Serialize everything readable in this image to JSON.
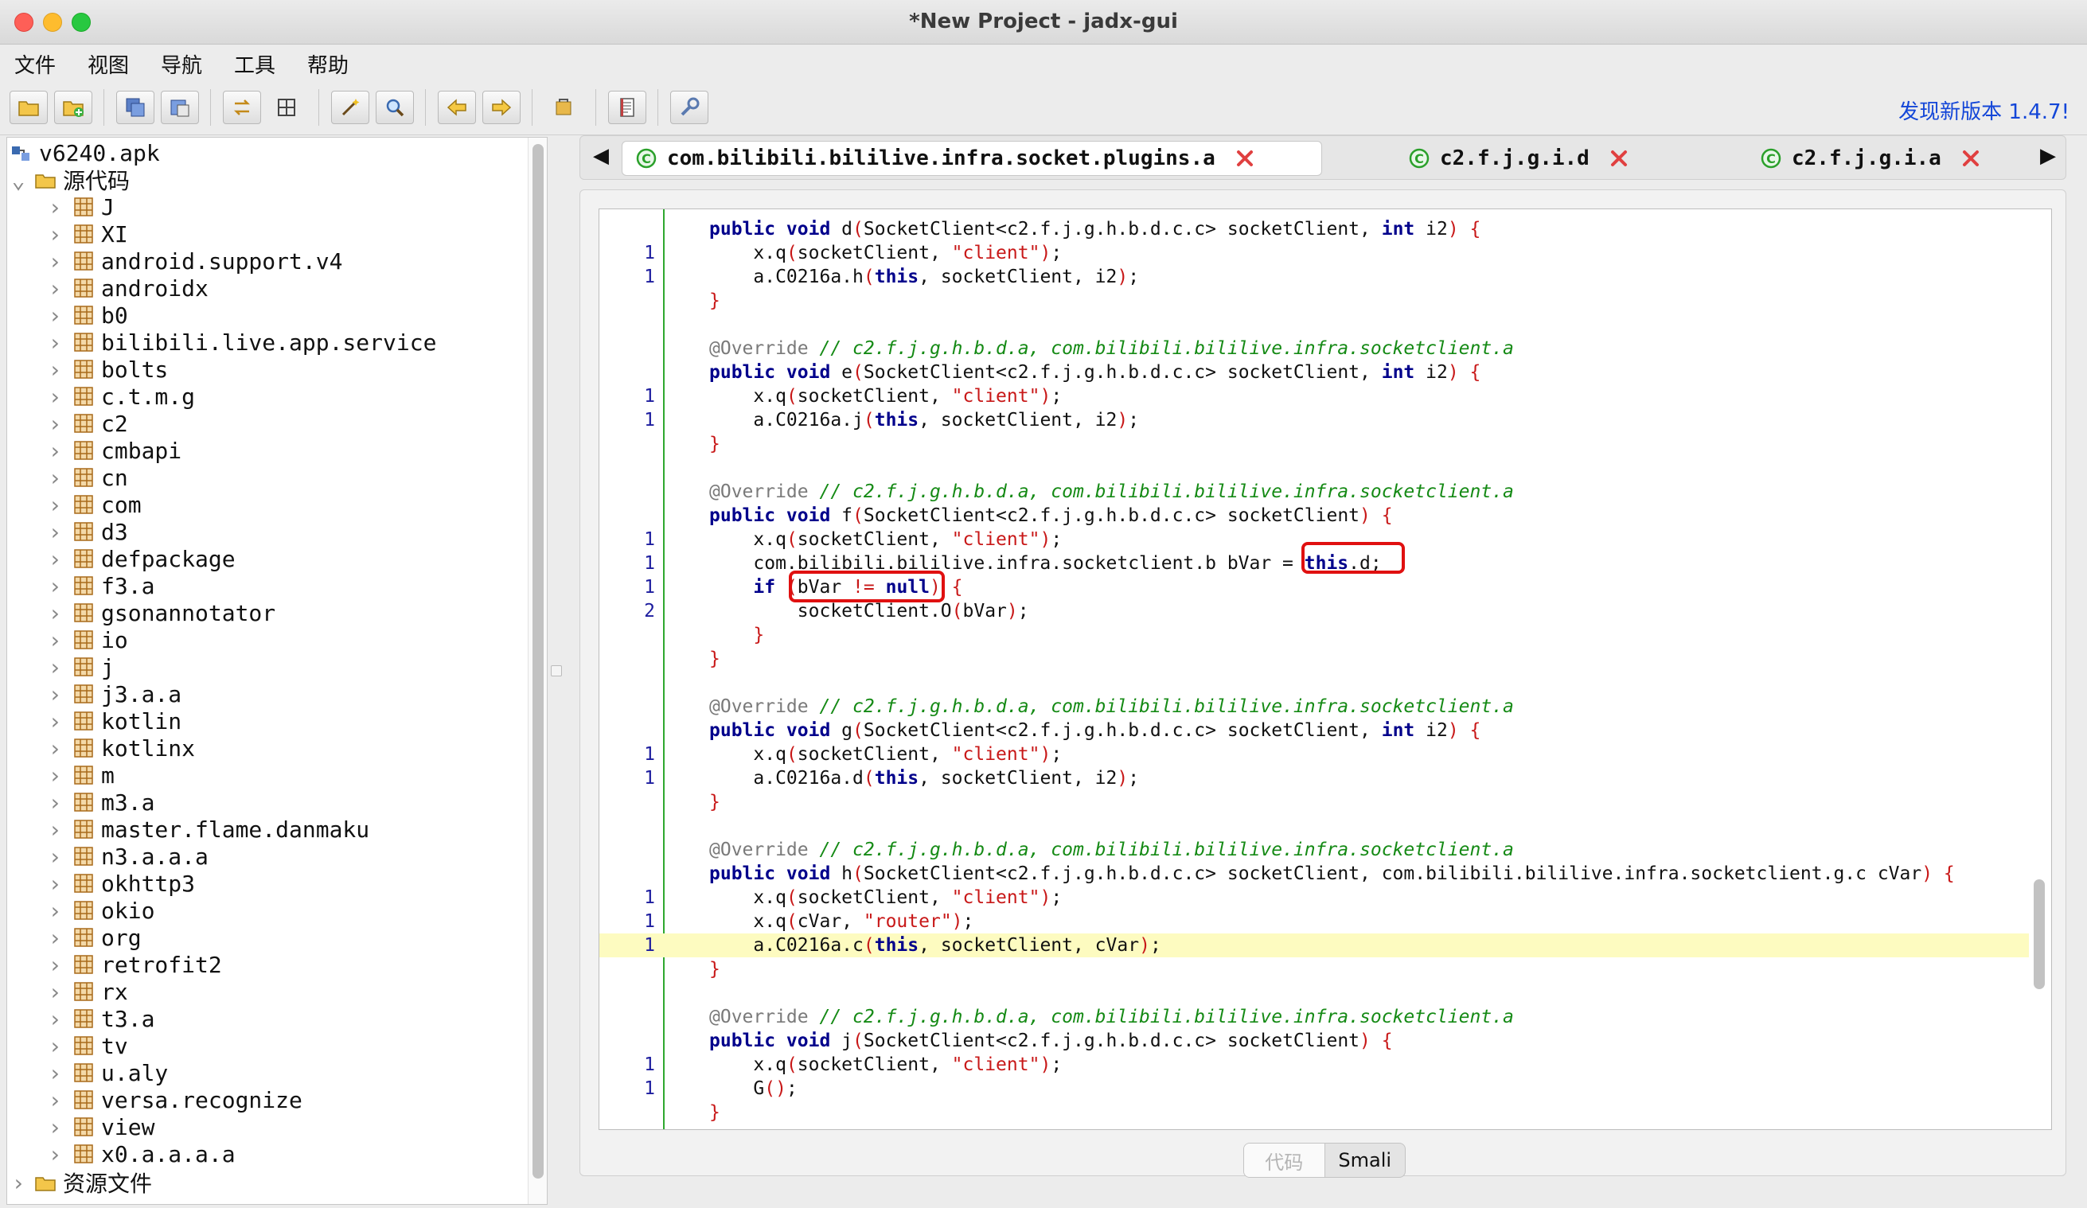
{
  "window": {
    "title": "*New Project - jadx-gui"
  },
  "menu": [
    "文件",
    "视图",
    "导航",
    "工具",
    "帮助"
  ],
  "toolbar": {
    "buttons": [
      {
        "icon": "open-folder-icon"
      },
      {
        "icon": "add-file-icon"
      },
      {
        "icon": "save-all-icon"
      },
      {
        "icon": "export-icon"
      },
      {
        "icon": "sync-icon"
      },
      {
        "icon": "flatten-icon"
      },
      {
        "icon": "magic-wand-icon"
      },
      {
        "icon": "search-icon"
      },
      {
        "icon": "back-arrow-icon"
      },
      {
        "icon": "forward-arrow-icon"
      },
      {
        "icon": "decompile-icon"
      },
      {
        "icon": "log-icon"
      },
      {
        "icon": "preferences-icon"
      }
    ],
    "update_link": "发现新版本 1.4.7!"
  },
  "tree": {
    "root": "v6240.apk",
    "source_folder": "源代码",
    "packages": [
      "J",
      "XI",
      "android.support.v4",
      "androidx",
      "b0",
      "bilibili.live.app.service",
      "bolts",
      "c.t.m.g",
      "c2",
      "cmbapi",
      "cn",
      "com",
      "d3",
      "defpackage",
      "f3.a",
      "gsonannotator",
      "io",
      "j",
      "j3.a.a",
      "kotlin",
      "kotlinx",
      "m",
      "m3.a",
      "master.flame.danmaku",
      "n3.a.a.a",
      "okhttp3",
      "okio",
      "org",
      "retrofit2",
      "rx",
      "t3.a",
      "tv",
      "u.aly",
      "versa.recognize",
      "view",
      "x0.a.a.a.a"
    ],
    "resources_folder": "资源文件"
  },
  "tabs": [
    {
      "label": "com.bilibili.bililive.infra.socket.plugins.a",
      "active": true
    },
    {
      "label": "c2.f.j.g.i.d",
      "active": false
    },
    {
      "label": "c2.f.j.g.i.a",
      "active": false
    }
  ],
  "code": [
    {
      "n": "",
      "s": [
        [
          "kw",
          "public void "
        ],
        [
          "tx",
          "d"
        ],
        [
          "pn",
          "("
        ],
        [
          "tx",
          "SocketClient<c2.f.j.g.h.b.d.c.c> socketClient, "
        ],
        [
          "kw",
          "int "
        ],
        [
          "tx",
          "i2"
        ],
        [
          "pn",
          ") {"
        ]
      ]
    },
    {
      "n": "1",
      "s": [
        [
          "tx",
          "    x.q"
        ],
        [
          "pn",
          "("
        ],
        [
          "tx",
          "socketClient, "
        ],
        [
          "str",
          "\"client\""
        ],
        [
          "pn",
          ")"
        ],
        [
          "tx",
          ";"
        ]
      ]
    },
    {
      "n": "1",
      "s": [
        [
          "tx",
          "    a.C0216a.h"
        ],
        [
          "pn",
          "("
        ],
        [
          "kw",
          "this"
        ],
        [
          "tx",
          ", socketClient, i2"
        ],
        [
          "pn",
          ")"
        ],
        [
          "tx",
          ";"
        ]
      ]
    },
    {
      "n": "",
      "s": [
        [
          "pn",
          "}"
        ]
      ]
    },
    {
      "n": "",
      "s": []
    },
    {
      "n": "",
      "s": [
        [
          "ann",
          "@Override "
        ],
        [
          "cm",
          "// c2.f.j.g.h.b.d.a, com.bilibili.bililive.infra.socketclient.a"
        ]
      ]
    },
    {
      "n": "",
      "s": [
        [
          "kw",
          "public void "
        ],
        [
          "tx",
          "e"
        ],
        [
          "pn",
          "("
        ],
        [
          "tx",
          "SocketClient<c2.f.j.g.h.b.d.c.c> socketClient, "
        ],
        [
          "kw",
          "int "
        ],
        [
          "tx",
          "i2"
        ],
        [
          "pn",
          ") {"
        ]
      ]
    },
    {
      "n": "1",
      "s": [
        [
          "tx",
          "    x.q"
        ],
        [
          "pn",
          "("
        ],
        [
          "tx",
          "socketClient, "
        ],
        [
          "str",
          "\"client\""
        ],
        [
          "pn",
          ")"
        ],
        [
          "tx",
          ";"
        ]
      ]
    },
    {
      "n": "1",
      "s": [
        [
          "tx",
          "    a.C0216a.j"
        ],
        [
          "pn",
          "("
        ],
        [
          "kw",
          "this"
        ],
        [
          "tx",
          ", socketClient, i2"
        ],
        [
          "pn",
          ")"
        ],
        [
          "tx",
          ";"
        ]
      ]
    },
    {
      "n": "",
      "s": [
        [
          "pn",
          "}"
        ]
      ]
    },
    {
      "n": "",
      "s": []
    },
    {
      "n": "",
      "s": [
        [
          "ann",
          "@Override "
        ],
        [
          "cm",
          "// c2.f.j.g.h.b.d.a, com.bilibili.bililive.infra.socketclient.a"
        ]
      ]
    },
    {
      "n": "",
      "s": [
        [
          "kw",
          "public void "
        ],
        [
          "tx",
          "f"
        ],
        [
          "pn",
          "("
        ],
        [
          "tx",
          "SocketClient<c2.f.j.g.h.b.d.c.c> socketClient"
        ],
        [
          "pn",
          ") {"
        ]
      ]
    },
    {
      "n": "1",
      "s": [
        [
          "tx",
          "    x.q"
        ],
        [
          "pn",
          "("
        ],
        [
          "tx",
          "socketClient, "
        ],
        [
          "str",
          "\"client\""
        ],
        [
          "pn",
          ")"
        ],
        [
          "tx",
          ";"
        ]
      ]
    },
    {
      "n": "1",
      "s": [
        [
          "tx",
          "    com.bilibili.bililive.infra.socketclient.b bVar = "
        ],
        [
          "kw",
          "this"
        ],
        [
          "tx",
          ".d;"
        ]
      ]
    },
    {
      "n": "1",
      "s": [
        [
          "kw",
          "    if "
        ],
        [
          "pn",
          "("
        ],
        [
          "tx",
          "bVar "
        ],
        [
          "pn",
          "!= "
        ],
        [
          "kw",
          "null"
        ],
        [
          "pn",
          ") {"
        ]
      ]
    },
    {
      "n": "2",
      "s": [
        [
          "tx",
          "        socketClient.O"
        ],
        [
          "pn",
          "("
        ],
        [
          "tx",
          "bVar"
        ],
        [
          "pn",
          ")"
        ],
        [
          "tx",
          ";"
        ]
      ]
    },
    {
      "n": "",
      "s": [
        [
          "pn",
          "    }"
        ]
      ]
    },
    {
      "n": "",
      "s": [
        [
          "pn",
          "}"
        ]
      ]
    },
    {
      "n": "",
      "s": []
    },
    {
      "n": "",
      "s": [
        [
          "ann",
          "@Override "
        ],
        [
          "cm",
          "// c2.f.j.g.h.b.d.a, com.bilibili.bililive.infra.socketclient.a"
        ]
      ]
    },
    {
      "n": "",
      "s": [
        [
          "kw",
          "public void "
        ],
        [
          "tx",
          "g"
        ],
        [
          "pn",
          "("
        ],
        [
          "tx",
          "SocketClient<c2.f.j.g.h.b.d.c.c> socketClient, "
        ],
        [
          "kw",
          "int "
        ],
        [
          "tx",
          "i2"
        ],
        [
          "pn",
          ") {"
        ]
      ]
    },
    {
      "n": "1",
      "s": [
        [
          "tx",
          "    x.q"
        ],
        [
          "pn",
          "("
        ],
        [
          "tx",
          "socketClient, "
        ],
        [
          "str",
          "\"client\""
        ],
        [
          "pn",
          ")"
        ],
        [
          "tx",
          ";"
        ]
      ]
    },
    {
      "n": "1",
      "s": [
        [
          "tx",
          "    a.C0216a.d"
        ],
        [
          "pn",
          "("
        ],
        [
          "kw",
          "this"
        ],
        [
          "tx",
          ", socketClient, i2"
        ],
        [
          "pn",
          ")"
        ],
        [
          "tx",
          ";"
        ]
      ]
    },
    {
      "n": "",
      "s": [
        [
          "pn",
          "}"
        ]
      ]
    },
    {
      "n": "",
      "s": []
    },
    {
      "n": "",
      "s": [
        [
          "ann",
          "@Override "
        ],
        [
          "cm",
          "// c2.f.j.g.h.b.d.a, com.bilibili.bililive.infra.socketclient.a"
        ]
      ]
    },
    {
      "n": "",
      "s": [
        [
          "kw",
          "public void "
        ],
        [
          "tx",
          "h"
        ],
        [
          "pn",
          "("
        ],
        [
          "tx",
          "SocketClient<c2.f.j.g.h.b.d.c.c> socketClient, com.bilibili.bililive.infra.socketclient.g.c cVar"
        ],
        [
          "pn",
          ") {"
        ]
      ]
    },
    {
      "n": "1",
      "s": [
        [
          "tx",
          "    x.q"
        ],
        [
          "pn",
          "("
        ],
        [
          "tx",
          "socketClient, "
        ],
        [
          "str",
          "\"client\""
        ],
        [
          "pn",
          ")"
        ],
        [
          "tx",
          ";"
        ]
      ]
    },
    {
      "n": "1",
      "s": [
        [
          "tx",
          "    x.q"
        ],
        [
          "pn",
          "("
        ],
        [
          "tx",
          "cVar, "
        ],
        [
          "str",
          "\"router\""
        ],
        [
          "pn",
          ")"
        ],
        [
          "tx",
          ";"
        ]
      ]
    },
    {
      "n": "1",
      "hl": true,
      "s": [
        [
          "tx",
          "    a.C0216a.c"
        ],
        [
          "pn",
          "("
        ],
        [
          "kw",
          "this"
        ],
        [
          "tx",
          ", socketClient, cVar"
        ],
        [
          "pn",
          ")"
        ],
        [
          "tx",
          ";"
        ]
      ]
    },
    {
      "n": "",
      "s": [
        [
          "pn",
          "}"
        ]
      ]
    },
    {
      "n": "",
      "s": []
    },
    {
      "n": "",
      "s": [
        [
          "ann",
          "@Override "
        ],
        [
          "cm",
          "// c2.f.j.g.h.b.d.a, com.bilibili.bililive.infra.socketclient.a"
        ]
      ]
    },
    {
      "n": "",
      "s": [
        [
          "kw",
          "public void "
        ],
        [
          "tx",
          "j"
        ],
        [
          "pn",
          "("
        ],
        [
          "tx",
          "SocketClient<c2.f.j.g.h.b.d.c.c> socketClient"
        ],
        [
          "pn",
          ") {"
        ]
      ]
    },
    {
      "n": "1",
      "s": [
        [
          "tx",
          "    x.q"
        ],
        [
          "pn",
          "("
        ],
        [
          "tx",
          "socketClient, "
        ],
        [
          "str",
          "\"client\""
        ],
        [
          "pn",
          ")"
        ],
        [
          "tx",
          ";"
        ]
      ]
    },
    {
      "n": "1",
      "s": [
        [
          "tx",
          "    G"
        ],
        [
          "pn",
          "()"
        ],
        [
          "tx",
          ";"
        ]
      ]
    },
    {
      "n": "",
      "s": [
        [
          "pn",
          "}"
        ]
      ]
    }
  ],
  "bottom_tabs": {
    "code": "代码",
    "smali": "Smali"
  }
}
